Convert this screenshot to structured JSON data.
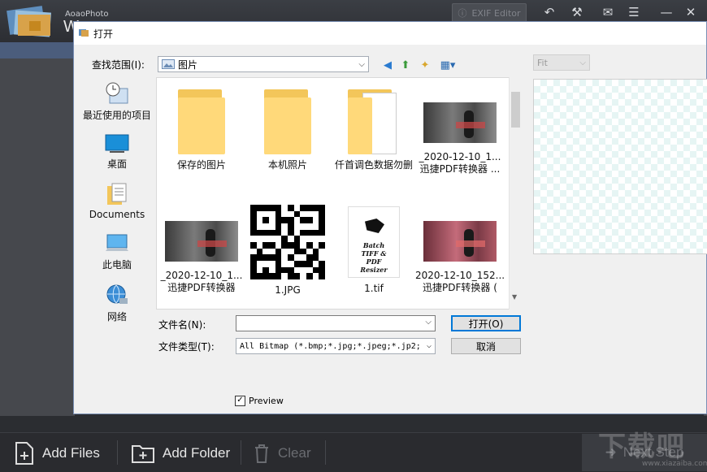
{
  "app": {
    "name": "AoaoPhoto",
    "title_fragment": "W",
    "exif_button": "EXIF Editor"
  },
  "bottom_toolbar": {
    "add_files": "Add Files",
    "add_folder": "Add Folder",
    "clear": "Clear",
    "next_step": "Next Step"
  },
  "dialog": {
    "title": "打开",
    "look_in_label": "查找范围(I):",
    "look_in_value": "图片",
    "places": [
      {
        "label": "最近使用的项目",
        "icon": "recent-items-icon"
      },
      {
        "label": "桌面",
        "icon": "desktop-icon"
      },
      {
        "label": "Documents",
        "icon": "documents-icon"
      },
      {
        "label": "此电脑",
        "icon": "computer-icon"
      },
      {
        "label": "网络",
        "icon": "network-icon"
      }
    ],
    "files": [
      {
        "name": "保存的图片",
        "type": "folder"
      },
      {
        "name": "本机照片",
        "type": "folder"
      },
      {
        "name": "仟首调色数据勿删",
        "type": "folder"
      },
      {
        "name": "_2020-12-10_1...",
        "name2": "迅捷PDF转换器 ...",
        "type": "photo"
      },
      {
        "name": "_2020-12-10_1...",
        "name2": "迅捷PDF转换器",
        "type": "photo"
      },
      {
        "name": "1.JPG",
        "type": "qr"
      },
      {
        "name": "1.tif",
        "type": "tif",
        "thumb_text": [
          "Batch",
          "TIFF &",
          "PDF",
          "Resizer"
        ]
      },
      {
        "name": "2020-12-10_152...",
        "name2": "迅捷PDF转换器 (",
        "type": "photo-red"
      }
    ],
    "filename_label": "文件名(N):",
    "filename_value": "",
    "filetype_label": "文件类型(T):",
    "filetype_value": "All Bitmap (*.bmp;*.jpg;*.jpeg;*.jp2;",
    "open_button": "打开(O)",
    "cancel_button": "取消",
    "preview_label": "Preview",
    "preview_checked": true,
    "fit_value": "Fit"
  },
  "watermark": {
    "text": "下载吧",
    "url": "www.xiazaiba.com"
  }
}
